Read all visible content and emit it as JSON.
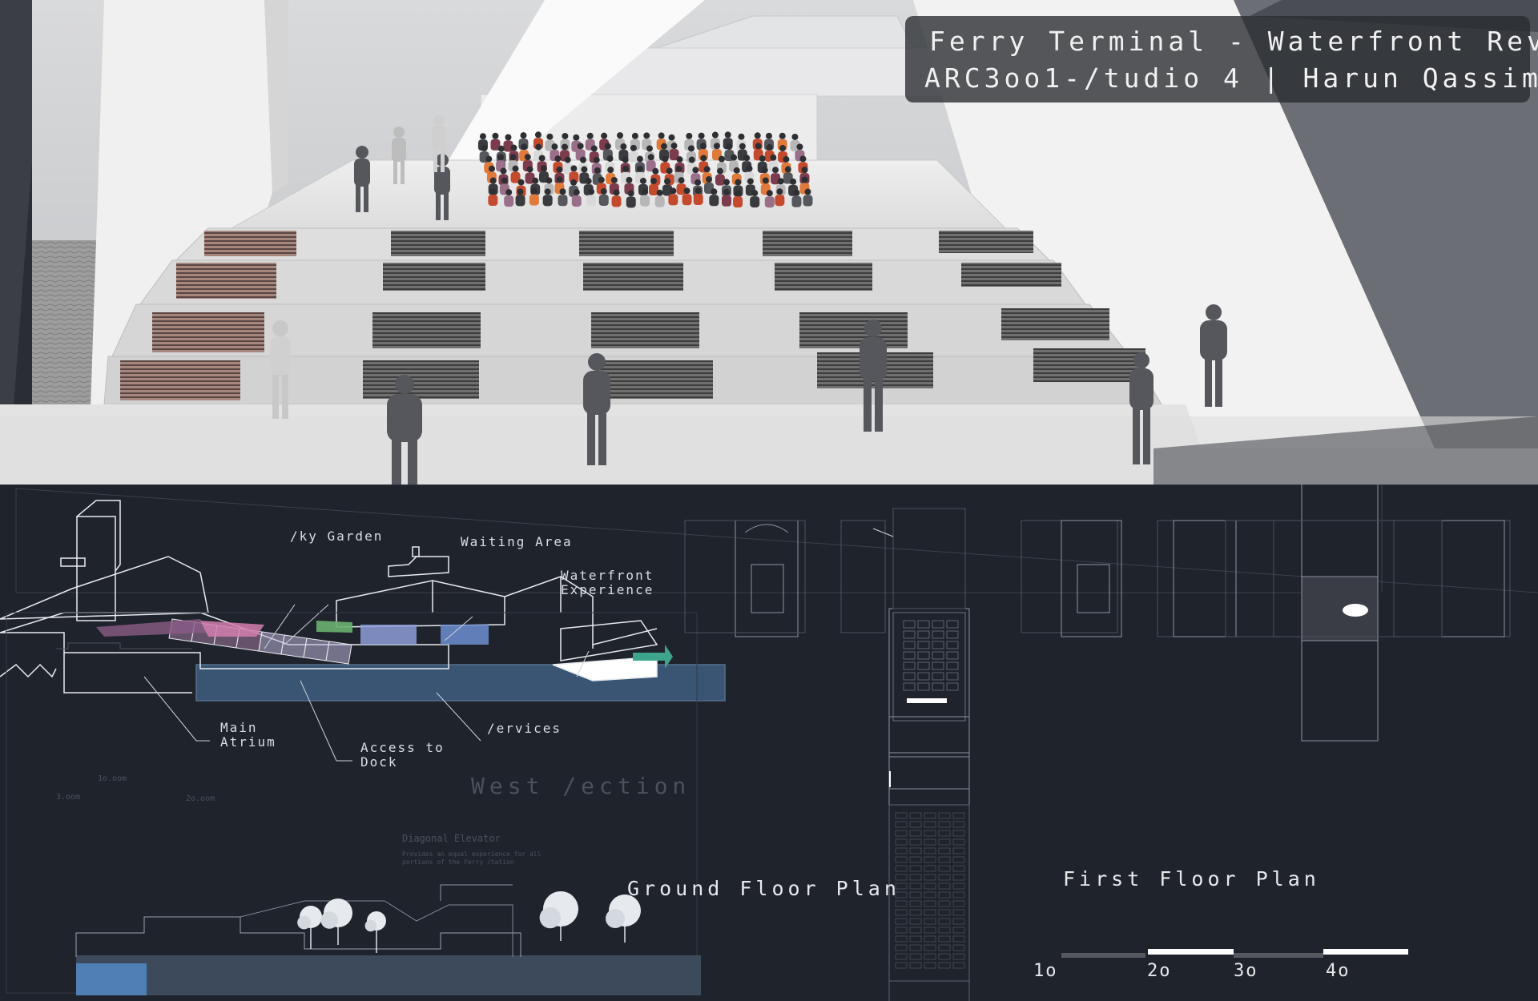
{
  "header": {
    "title": "Ferry Terminal -  Waterfront Revial",
    "subtitle": "ARC3oo1-/tudio 4   |   Harun Qassim"
  },
  "section_labels": {
    "sky_garden": "/ky Garden",
    "waiting_area": "Waiting Area",
    "waterfront_experience": "Waterfront\nExperience",
    "main_atrium": "Main\nAtrium",
    "access_to_dock": "Access to\nDock",
    "services": "/ervices"
  },
  "west_section": {
    "title": "West /ection",
    "heights": [
      "1o.oom",
      "3.oom",
      "2o.oom"
    ],
    "note_title": "Diagonal Elevator",
    "note_body": "Provides an equal experience for all\nportions of the Ferry /tation"
  },
  "plans": {
    "ground_floor": "Ground Floor Plan",
    "first_floor": "First Floor Plan"
  },
  "scale_bar": {
    "ticks": [
      "1o",
      "2o",
      "3o",
      "4o"
    ]
  },
  "colors": {
    "board_bg": "#1f232b",
    "title_card": "#2a2c30",
    "line": "#e8ebf0",
    "water": "#3a5574"
  }
}
